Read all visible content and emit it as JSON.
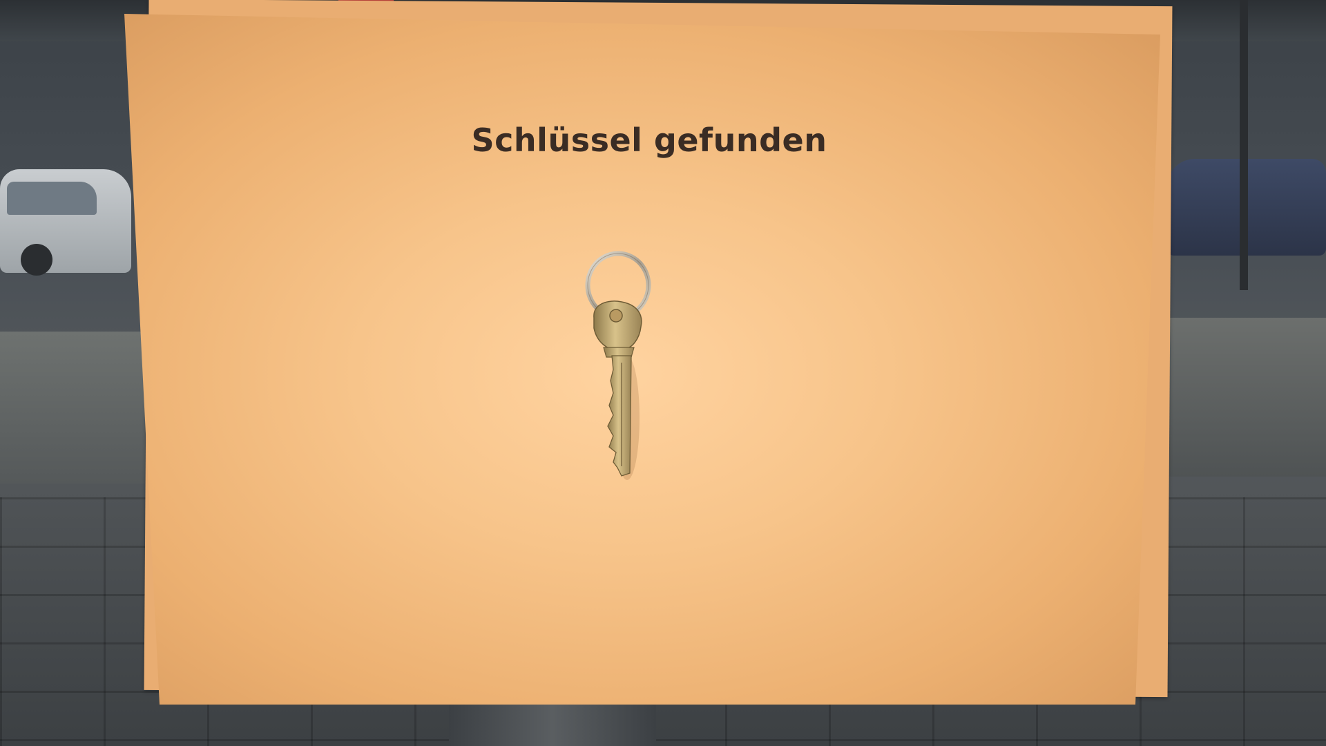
{
  "sign": {
    "title": "Schlüssel gefunden"
  },
  "colors": {
    "paper": "#f7c48a",
    "paper_edge": "#d99b5f",
    "text": "#3a2c24",
    "key_metal": "#c9b27a",
    "ring_metal": "#c7bfb0"
  },
  "objects": {
    "key_icon": "key-icon",
    "ring_icon": "key-ring-icon"
  }
}
